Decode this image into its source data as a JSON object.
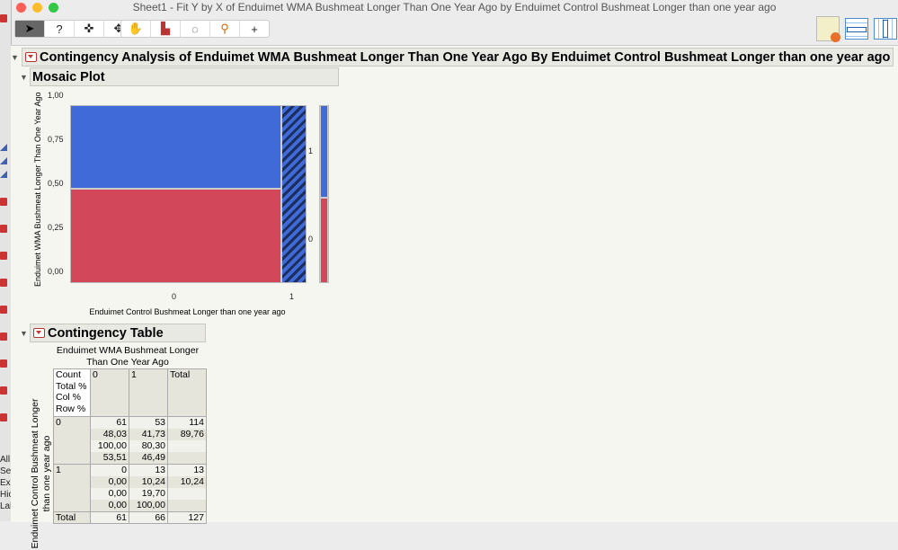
{
  "window": {
    "title": "Sheet1 - Fit Y by X of Enduimet WMA Bushmeat Longer Than One Year Ago by Enduimet Control Bushmeat Longer than one year ago"
  },
  "left_panel": {
    "items": [
      "All",
      "Sel",
      "Exc",
      "Hic",
      "Lab"
    ]
  },
  "toolbar": {
    "tools": [
      "arrow-tool",
      "help-tool",
      "selection-tool",
      "move-tool",
      "grabber-tool",
      "brush-tool",
      "lasso-tool",
      "magnifier-tool",
      "crosshair-tool"
    ],
    "help_label": "?"
  },
  "report": {
    "title": "Contingency Analysis of Enduimet WMA Bushmeat Longer Than One Year Ago By Enduimet Control Bushmeat Longer than one year ago",
    "mosaic": {
      "title": "Mosaic Plot",
      "ylabel": "Enduimet WMA Bushmeat Longer Than One Year Ago",
      "xlabel": "Enduimet Control Bushmeat Longer than one year ago",
      "yticks": [
        "1,00",
        "0,75",
        "0,50",
        "0,25",
        "0,00"
      ],
      "xticks": [
        "0",
        "1"
      ],
      "legend_levels": [
        "1",
        "0"
      ],
      "col_share": {
        "0": 0.898,
        "1": 0.102
      },
      "prop_y1_in_col0": 0.4649,
      "prop_y1_in_col1": 1.0,
      "prop_y1_overall": 0.5197,
      "colors": {
        "level1": "#3f6ad8",
        "level0": "#d2485a"
      }
    },
    "table": {
      "title": "Contingency Table",
      "col_header": "Enduimet WMA Bushmeat Longer Than One Year Ago",
      "row_header": "Enduimet Control Bushmeat Longer than one year ago",
      "stat_labels": [
        "Count",
        "Total %",
        "Col %",
        "Row %"
      ],
      "columns": [
        "0",
        "1",
        "Total"
      ],
      "rows": [
        {
          "label": "0",
          "cells": [
            [
              "61",
              "48,03",
              "100,00",
              "53,51"
            ],
            [
              "53",
              "41,73",
              "80,30",
              "46,49"
            ],
            [
              "114",
              "89,76",
              "",
              ""
            ]
          ]
        },
        {
          "label": "1",
          "cells": [
            [
              "0",
              "0,00",
              "0,00",
              "0,00"
            ],
            [
              "13",
              "10,24",
              "19,70",
              "100,00"
            ],
            [
              "13",
              "10,24",
              "",
              ""
            ]
          ]
        }
      ],
      "total": {
        "label": "Total",
        "values": [
          "61",
          "66",
          "127"
        ]
      }
    }
  }
}
